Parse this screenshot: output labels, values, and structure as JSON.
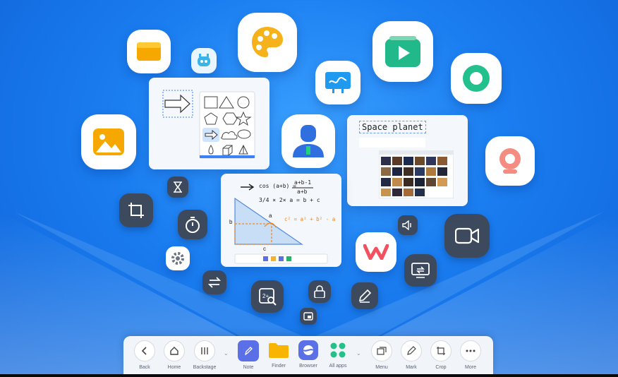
{
  "cards": {
    "whiteboard_title": "Space planet",
    "math_line1": "cos (a+b) =",
    "math_frac_top": "a+b-1",
    "math_frac_bottom": "a+b",
    "math_line2": "3/4 × 2× a = b + c",
    "math_orange": "c² = a² + b² - a",
    "math_label_a": "a",
    "math_label_b": "b",
    "math_label_c": "c"
  },
  "dock": {
    "items": [
      {
        "label": "Back",
        "icon": "chevron-left-icon"
      },
      {
        "label": "Home",
        "icon": "home-icon"
      },
      {
        "label": "Backstage",
        "icon": "bars-icon"
      },
      {
        "label": "Note",
        "icon": "note-app-icon"
      },
      {
        "label": "Finder",
        "icon": "folder-icon"
      },
      {
        "label": "Browser",
        "icon": "browser-icon"
      },
      {
        "label": "All apps",
        "icon": "grid-icon"
      },
      {
        "label": "Menu",
        "icon": "menu-windows-icon"
      },
      {
        "label": "Mark",
        "icon": "pen-icon"
      },
      {
        "label": "Crop",
        "icon": "crop-icon"
      },
      {
        "label": "More",
        "icon": "more-icon"
      }
    ]
  },
  "colors": {
    "background": "#1a7df0",
    "dark_tile": "#3d4a5e",
    "folder_yellow": "#f7b500",
    "green_accent": "#23c08a",
    "note_purple": "#5b6fe6"
  }
}
